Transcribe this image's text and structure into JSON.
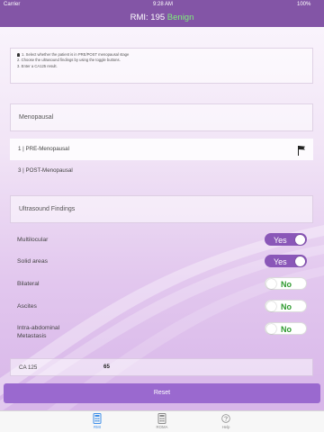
{
  "status_bar": {
    "carrier": "Carrier",
    "time": "9:28 AM",
    "battery": "100%"
  },
  "header": {
    "title": "RMI: 195",
    "status": "Benign"
  },
  "instructions": [
    "1. Select whether the patient is in PRE/POST menopausal stage",
    "2. Choose the ultrasound findings by using the toggle buttons.",
    "3. Enter a CA125 result."
  ],
  "menopausal": {
    "title": "Menopausal",
    "options": [
      {
        "label": "1 | PRE-Menopausal",
        "selected": true
      },
      {
        "label": "3 | POST-Menopausal",
        "selected": false
      }
    ]
  },
  "ultrasound": {
    "title": "Ultrasound Findings",
    "findings": [
      {
        "label": "Multilocular",
        "value": "Yes"
      },
      {
        "label": "Solid areas",
        "value": "Yes"
      },
      {
        "label": "Bilateral",
        "value": "No"
      },
      {
        "label": "Ascites",
        "value": "No"
      },
      {
        "label_line1": "Intra-abdominal",
        "label_line2": "Metastasis",
        "value": "No"
      }
    ]
  },
  "ca125": {
    "label": "CA 125",
    "value": "65"
  },
  "reset_label": "Reset",
  "tabs": [
    {
      "label": "RMI",
      "icon": "rmi-icon",
      "active": true
    },
    {
      "label": "ROMA",
      "icon": "calculator-icon",
      "active": false
    },
    {
      "label": "Help",
      "icon": "help-icon",
      "active": false
    }
  ],
  "colors": {
    "header": "#8355a6",
    "accent": "#8a57b8",
    "reset": "#9a69cf",
    "benign": "#7ef07a",
    "toggle_no": "#2e9a2e",
    "tab_active": "#3f8fe8"
  }
}
